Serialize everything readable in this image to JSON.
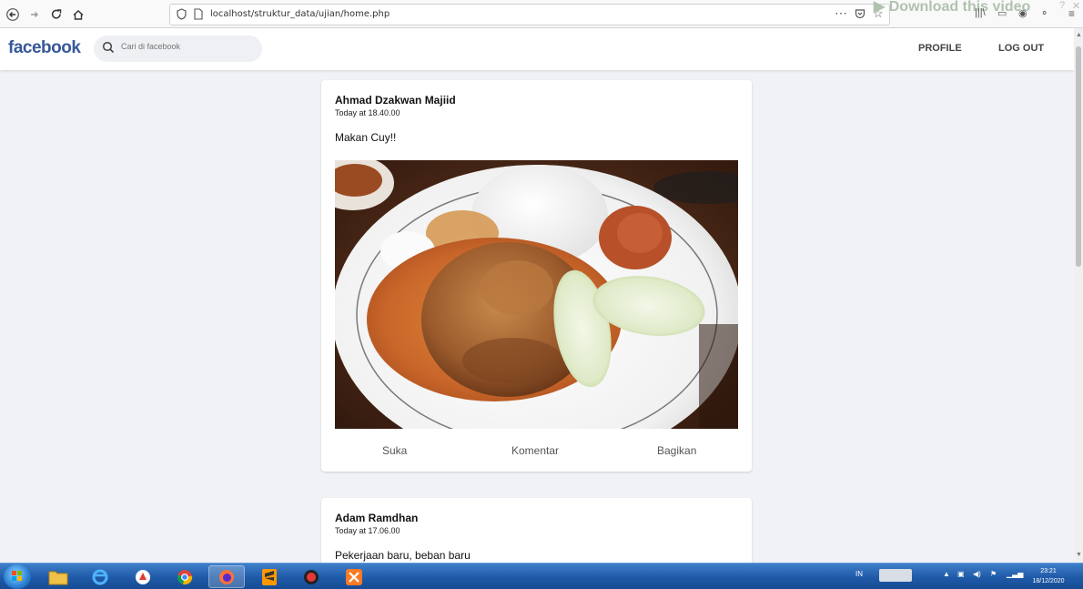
{
  "browser": {
    "url": "localhost/struktur_data/ujian/home.php",
    "overlay_text": "Download this video"
  },
  "header": {
    "logo": "facebook",
    "search_placeholder": "Cari di facebook",
    "nav": [
      "PROFILE",
      "LOG OUT"
    ]
  },
  "posts": [
    {
      "author": "Ahmad Dzakwan Majiid",
      "time": "Today at 18.40.00",
      "text": "Makan Cuy!!",
      "actions": [
        "Suka",
        "Komentar",
        "Bagikan"
      ]
    },
    {
      "author": "Adam Ramdhan",
      "time": "Today at 17.06.00",
      "text": "Pekerjaan baru, beban baru"
    }
  ],
  "taskbar": {
    "lang": "IN",
    "time": "23:21",
    "date": "18/12/2020"
  },
  "colors": {
    "brand": "#385898",
    "page_bg": "#f0f2f5",
    "taskbar": "#1f5aa8"
  }
}
